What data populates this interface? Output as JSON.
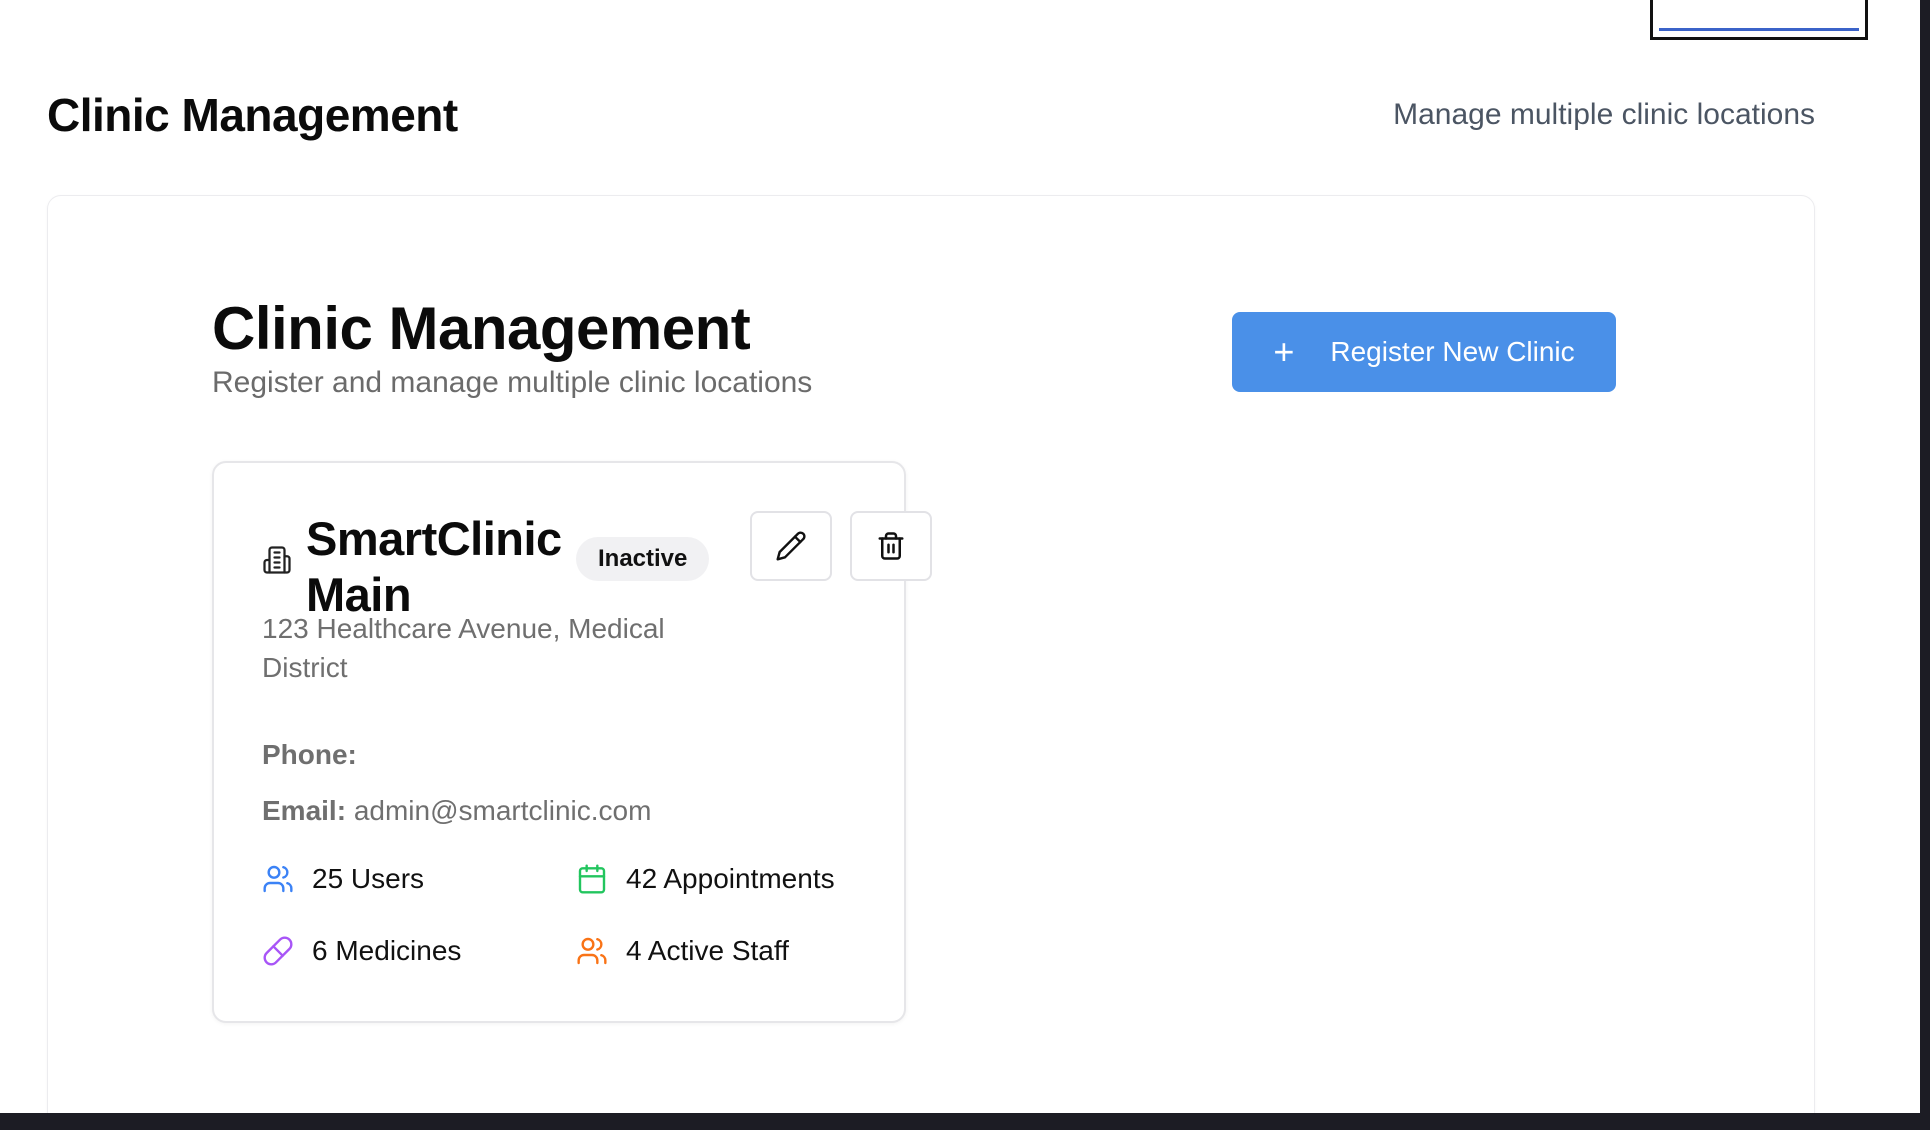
{
  "header": {
    "title": "Clinic Management",
    "subtitle": "Manage multiple clinic locations"
  },
  "section": {
    "title": "Clinic Management",
    "description": "Register and manage multiple clinic locations",
    "register_button_label": "Register New Clinic"
  },
  "clinic": {
    "name": "SmartClinic Main",
    "status": "Inactive",
    "address": "123 Healthcare Avenue, Medical District",
    "phone_label": "Phone:",
    "phone_value": "",
    "email_label": "Email:",
    "email_value": "admin@smartclinic.com",
    "stats": [
      {
        "icon": "users-icon",
        "text": "25 Users",
        "color": "#3b82f6"
      },
      {
        "icon": "calendar-icon",
        "text": "42 Appointments",
        "color": "#22c55e"
      },
      {
        "icon": "pill-icon",
        "text": "6 Medicines",
        "color": "#a855f7"
      },
      {
        "icon": "staff-icon",
        "text": "4 Active Staff",
        "color": "#f97316"
      }
    ]
  },
  "colors": {
    "primary": "#4a90e8",
    "badge_bg": "#f1f1f3",
    "muted_text": "#6f6f6f"
  }
}
